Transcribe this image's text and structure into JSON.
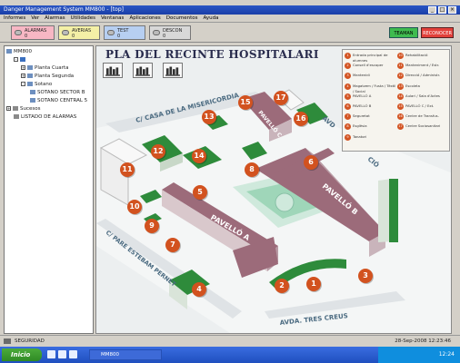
{
  "window": {
    "title": "Danger Management System MM800 - [top]"
  },
  "menu": [
    "Informes",
    "Ver",
    "Alarmas",
    "Utilidades",
    "Ventanas",
    "Aplicaciones",
    "Documentos",
    "Ayuda"
  ],
  "alarm_toolbar": {
    "alarmas": {
      "label": "ALARMAS",
      "count": "0"
    },
    "averias": {
      "label": "AVERIAS",
      "count": "0"
    },
    "test": {
      "label": "TEST",
      "count": "0"
    },
    "desconx": {
      "label": "DESCON",
      "count": "0"
    },
    "teaman_label": "TEAMAN",
    "reconocer_label": "RECONOCER"
  },
  "tree": {
    "items": [
      {
        "label": "MM800",
        "indent": 0
      },
      {
        "label": "",
        "indent": 1
      },
      {
        "label": "Planta Cuarta",
        "indent": 1
      },
      {
        "label": "Planta Segunda",
        "indent": 1
      },
      {
        "label": "Sotano",
        "indent": 1
      },
      {
        "label": "SOTANO SECTOR B",
        "indent": 2
      },
      {
        "label": "SOTANO CENTRAL 5",
        "indent": 2
      },
      {
        "label": "Sucesos",
        "indent": 0
      },
      {
        "label": "LISTADO DE ALARMAS",
        "indent": 0
      }
    ]
  },
  "map": {
    "title": "PLA DEL RECINTE HOSPITALARI",
    "streets": {
      "casa": "C/ CASA DE LA MISERICORDIA",
      "estebam": "C/ PARE ESTEBAM PERNET",
      "tres_creus": "AVDA. TRES CREUS",
      "avd_right": "AVD",
      "cio": "CIÓ"
    },
    "buildings": {
      "pavello_a": "PAVELLÓ A",
      "pavello_b": "PAVELLÓ B",
      "pavello_c": "PAVELLÓ C"
    },
    "markers": [
      "1",
      "2",
      "3",
      "4",
      "5",
      "6",
      "7",
      "8",
      "9",
      "10",
      "11",
      "12",
      "13",
      "14",
      "15",
      "16",
      "17"
    ]
  },
  "legend": {
    "left": [
      {
        "n": "1",
        "text": "Entrada principal de alumnes"
      },
      {
        "n": "2",
        "text": "Consell d'escoper"
      },
      {
        "n": "3",
        "text": "Mantenidi"
      },
      {
        "n": "4",
        "text": "Magatzem / Fusta / Tèxtil / Social"
      },
      {
        "n": "5",
        "text": "PAVELLÓ A"
      },
      {
        "n": "6",
        "text": "PAVELLÓ B"
      },
      {
        "n": "7",
        "text": "Seguretat"
      },
      {
        "n": "8",
        "text": "Esglèsia"
      },
      {
        "n": "9",
        "text": "Tanatori"
      }
    ],
    "right": [
      {
        "n": "10",
        "text": "Rehabilitació"
      },
      {
        "n": "11",
        "text": "Manteniment / Estr."
      },
      {
        "n": "12",
        "text": "Direcció / Administr."
      },
      {
        "n": "13",
        "text": "Escoleta"
      },
      {
        "n": "14",
        "text": "Aulari / Sala d'Actes"
      },
      {
        "n": "15",
        "text": "PAVELLÓ C / Ext."
      },
      {
        "n": "16",
        "text": "Centre de Transfus."
      },
      {
        "n": "17",
        "text": "Centre Sociosanitari"
      }
    ]
  },
  "status": {
    "text": "SEGURIDAD",
    "time": "28-Sep-2008  12:23:46"
  },
  "taskbar": {
    "start_label": "Inicio",
    "app_label": "MM800",
    "clock": "12:24"
  }
}
